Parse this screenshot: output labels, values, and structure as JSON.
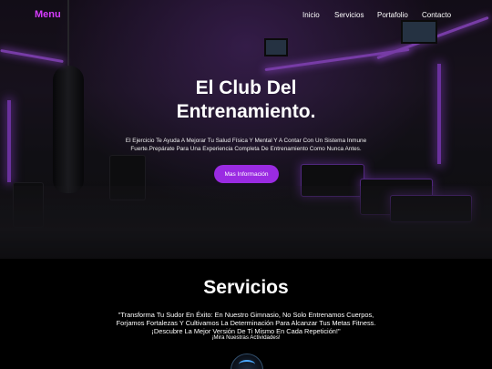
{
  "nav": {
    "brand": "Menu",
    "links": [
      "Inicio",
      "Servicios",
      "Portafolio",
      "Contacto"
    ]
  },
  "hero": {
    "title_line1": "El Club Del",
    "title_line2": "Entrenamiento.",
    "text_line1": "El Ejercicio Te Ayuda A Mejorar Tu Salud Física Y Mental Y A Contar Con Un Sistema Inmune",
    "text_line2": "Fuerte.Prepárate Para Una Experiencia Completa De Entrenamiento Como Nunca Antes.",
    "button": "Mas Información"
  },
  "services": {
    "title": "Servicios",
    "line1": "\"Transforma Tu Sudor En Éxito: En Nuestro Gimnasio, No Solo Entrenamos Cuerpos,",
    "line2": "Forjamos Fortalezas Y Cultivamos La Determinación Para Alcanzar Tus Metas Fitness.",
    "line3": "¡Descubre La Mejor Versión De Ti Mismo En Cada Repetición!\"",
    "sub": "¡Mira Nuestras Actividades!"
  },
  "colors": {
    "brand": "#d63cff",
    "button": "#9a2be2",
    "neon": "#b75cff"
  }
}
